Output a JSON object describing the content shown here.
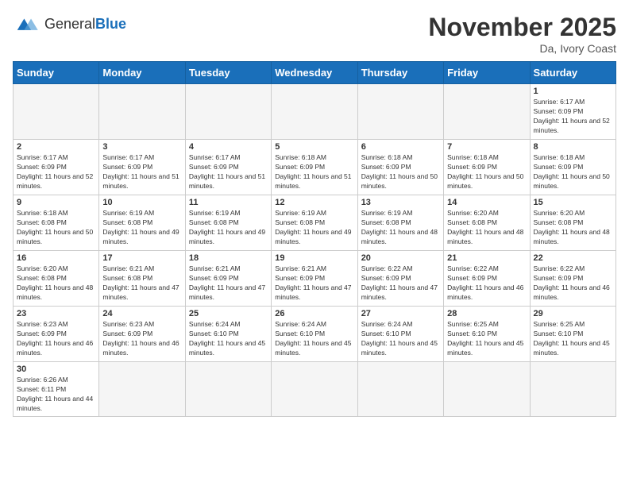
{
  "header": {
    "logo_general": "General",
    "logo_blue": "Blue",
    "month_title": "November 2025",
    "location": "Da, Ivory Coast"
  },
  "days_of_week": [
    "Sunday",
    "Monday",
    "Tuesday",
    "Wednesday",
    "Thursday",
    "Friday",
    "Saturday"
  ],
  "weeks": [
    [
      {
        "day": "",
        "empty": true
      },
      {
        "day": "",
        "empty": true
      },
      {
        "day": "",
        "empty": true
      },
      {
        "day": "",
        "empty": true
      },
      {
        "day": "",
        "empty": true
      },
      {
        "day": "",
        "empty": true
      },
      {
        "day": "1",
        "sunrise": "Sunrise: 6:17 AM",
        "sunset": "Sunset: 6:09 PM",
        "daylight": "Daylight: 11 hours and 52 minutes."
      }
    ],
    [
      {
        "day": "2",
        "sunrise": "Sunrise: 6:17 AM",
        "sunset": "Sunset: 6:09 PM",
        "daylight": "Daylight: 11 hours and 52 minutes."
      },
      {
        "day": "3",
        "sunrise": "Sunrise: 6:17 AM",
        "sunset": "Sunset: 6:09 PM",
        "daylight": "Daylight: 11 hours and 51 minutes."
      },
      {
        "day": "4",
        "sunrise": "Sunrise: 6:17 AM",
        "sunset": "Sunset: 6:09 PM",
        "daylight": "Daylight: 11 hours and 51 minutes."
      },
      {
        "day": "5",
        "sunrise": "Sunrise: 6:18 AM",
        "sunset": "Sunset: 6:09 PM",
        "daylight": "Daylight: 11 hours and 51 minutes."
      },
      {
        "day": "6",
        "sunrise": "Sunrise: 6:18 AM",
        "sunset": "Sunset: 6:09 PM",
        "daylight": "Daylight: 11 hours and 50 minutes."
      },
      {
        "day": "7",
        "sunrise": "Sunrise: 6:18 AM",
        "sunset": "Sunset: 6:09 PM",
        "daylight": "Daylight: 11 hours and 50 minutes."
      },
      {
        "day": "8",
        "sunrise": "Sunrise: 6:18 AM",
        "sunset": "Sunset: 6:09 PM",
        "daylight": "Daylight: 11 hours and 50 minutes."
      }
    ],
    [
      {
        "day": "9",
        "sunrise": "Sunrise: 6:18 AM",
        "sunset": "Sunset: 6:08 PM",
        "daylight": "Daylight: 11 hours and 50 minutes."
      },
      {
        "day": "10",
        "sunrise": "Sunrise: 6:19 AM",
        "sunset": "Sunset: 6:08 PM",
        "daylight": "Daylight: 11 hours and 49 minutes."
      },
      {
        "day": "11",
        "sunrise": "Sunrise: 6:19 AM",
        "sunset": "Sunset: 6:08 PM",
        "daylight": "Daylight: 11 hours and 49 minutes."
      },
      {
        "day": "12",
        "sunrise": "Sunrise: 6:19 AM",
        "sunset": "Sunset: 6:08 PM",
        "daylight": "Daylight: 11 hours and 49 minutes."
      },
      {
        "day": "13",
        "sunrise": "Sunrise: 6:19 AM",
        "sunset": "Sunset: 6:08 PM",
        "daylight": "Daylight: 11 hours and 48 minutes."
      },
      {
        "day": "14",
        "sunrise": "Sunrise: 6:20 AM",
        "sunset": "Sunset: 6:08 PM",
        "daylight": "Daylight: 11 hours and 48 minutes."
      },
      {
        "day": "15",
        "sunrise": "Sunrise: 6:20 AM",
        "sunset": "Sunset: 6:08 PM",
        "daylight": "Daylight: 11 hours and 48 minutes."
      }
    ],
    [
      {
        "day": "16",
        "sunrise": "Sunrise: 6:20 AM",
        "sunset": "Sunset: 6:08 PM",
        "daylight": "Daylight: 11 hours and 48 minutes."
      },
      {
        "day": "17",
        "sunrise": "Sunrise: 6:21 AM",
        "sunset": "Sunset: 6:08 PM",
        "daylight": "Daylight: 11 hours and 47 minutes."
      },
      {
        "day": "18",
        "sunrise": "Sunrise: 6:21 AM",
        "sunset": "Sunset: 6:09 PM",
        "daylight": "Daylight: 11 hours and 47 minutes."
      },
      {
        "day": "19",
        "sunrise": "Sunrise: 6:21 AM",
        "sunset": "Sunset: 6:09 PM",
        "daylight": "Daylight: 11 hours and 47 minutes."
      },
      {
        "day": "20",
        "sunrise": "Sunrise: 6:22 AM",
        "sunset": "Sunset: 6:09 PM",
        "daylight": "Daylight: 11 hours and 47 minutes."
      },
      {
        "day": "21",
        "sunrise": "Sunrise: 6:22 AM",
        "sunset": "Sunset: 6:09 PM",
        "daylight": "Daylight: 11 hours and 46 minutes."
      },
      {
        "day": "22",
        "sunrise": "Sunrise: 6:22 AM",
        "sunset": "Sunset: 6:09 PM",
        "daylight": "Daylight: 11 hours and 46 minutes."
      }
    ],
    [
      {
        "day": "23",
        "sunrise": "Sunrise: 6:23 AM",
        "sunset": "Sunset: 6:09 PM",
        "daylight": "Daylight: 11 hours and 46 minutes."
      },
      {
        "day": "24",
        "sunrise": "Sunrise: 6:23 AM",
        "sunset": "Sunset: 6:09 PM",
        "daylight": "Daylight: 11 hours and 46 minutes."
      },
      {
        "day": "25",
        "sunrise": "Sunrise: 6:24 AM",
        "sunset": "Sunset: 6:10 PM",
        "daylight": "Daylight: 11 hours and 45 minutes."
      },
      {
        "day": "26",
        "sunrise": "Sunrise: 6:24 AM",
        "sunset": "Sunset: 6:10 PM",
        "daylight": "Daylight: 11 hours and 45 minutes."
      },
      {
        "day": "27",
        "sunrise": "Sunrise: 6:24 AM",
        "sunset": "Sunset: 6:10 PM",
        "daylight": "Daylight: 11 hours and 45 minutes."
      },
      {
        "day": "28",
        "sunrise": "Sunrise: 6:25 AM",
        "sunset": "Sunset: 6:10 PM",
        "daylight": "Daylight: 11 hours and 45 minutes."
      },
      {
        "day": "29",
        "sunrise": "Sunrise: 6:25 AM",
        "sunset": "Sunset: 6:10 PM",
        "daylight": "Daylight: 11 hours and 45 minutes."
      }
    ],
    [
      {
        "day": "30",
        "sunrise": "Sunrise: 6:26 AM",
        "sunset": "Sunset: 6:11 PM",
        "daylight": "Daylight: 11 hours and 44 minutes."
      },
      {
        "day": "",
        "empty": true
      },
      {
        "day": "",
        "empty": true
      },
      {
        "day": "",
        "empty": true
      },
      {
        "day": "",
        "empty": true
      },
      {
        "day": "",
        "empty": true
      },
      {
        "day": "",
        "empty": true
      }
    ]
  ]
}
